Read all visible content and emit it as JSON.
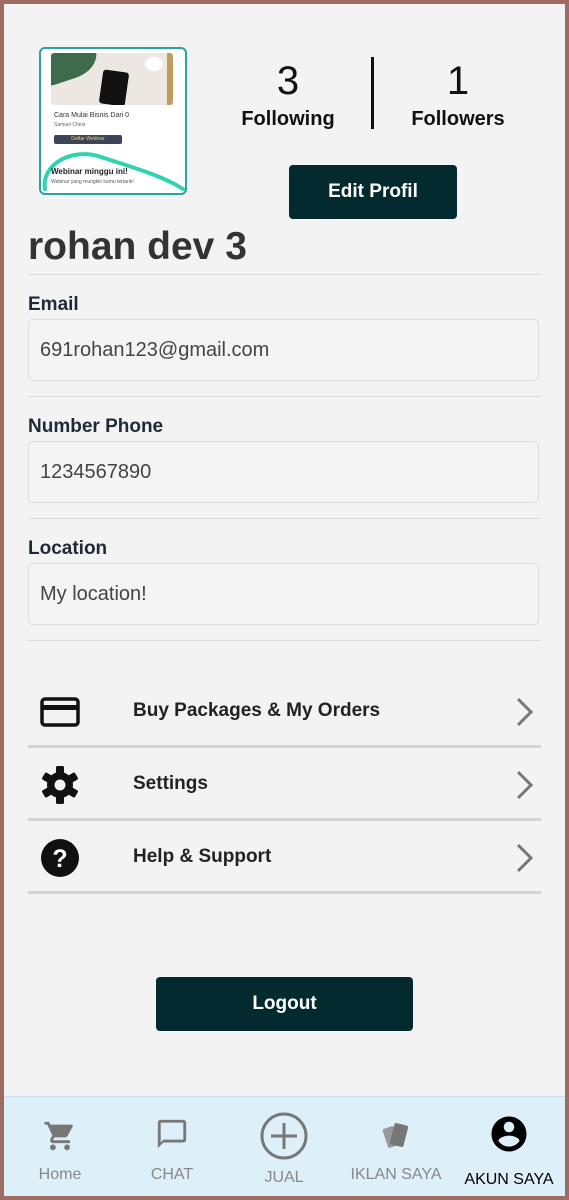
{
  "avatar": {
    "card_title": "Cara Mulai Bisnis Dari 0",
    "card_author": "Samuel Christ",
    "card_button": "Daftar Webinar",
    "card_headline": "Webinar minggu ini!",
    "card_caption": "Webinar yang mungkin kamu tertarik!"
  },
  "stats": {
    "following_count": "3",
    "following_label": "Following",
    "followers_count": "1",
    "followers_label": "Followers"
  },
  "edit_profile_label": "Edit Profil",
  "profile_name": "rohan dev 3",
  "fields": {
    "email_label": "Email",
    "email_value": "691rohan123@gmail.com",
    "phone_label": "Number Phone",
    "phone_value": "1234567890",
    "location_label": "Location",
    "location_value": "My location!"
  },
  "menu": [
    {
      "label": "Buy Packages & My Orders",
      "icon": "credit-card-icon"
    },
    {
      "label": "Settings",
      "icon": "gear-icon"
    },
    {
      "label": "Help & Support",
      "icon": "help-circle-icon"
    }
  ],
  "logout_label": "Logout",
  "nav": [
    {
      "label": "Home",
      "icon": "cart-icon"
    },
    {
      "label": "CHAT",
      "icon": "chat-icon"
    },
    {
      "label": "JUAL",
      "icon": "plus-circle-icon"
    },
    {
      "label": "IKLAN SAYA",
      "icon": "cards-icon"
    },
    {
      "label": "AKUN SAYA",
      "icon": "account-icon",
      "active": true
    }
  ],
  "colors": {
    "primary_dark": "#032a2e",
    "nav_background": "#ddeff9",
    "avatar_border": "#2ba3a0",
    "frame_border": "#9e6b62"
  }
}
